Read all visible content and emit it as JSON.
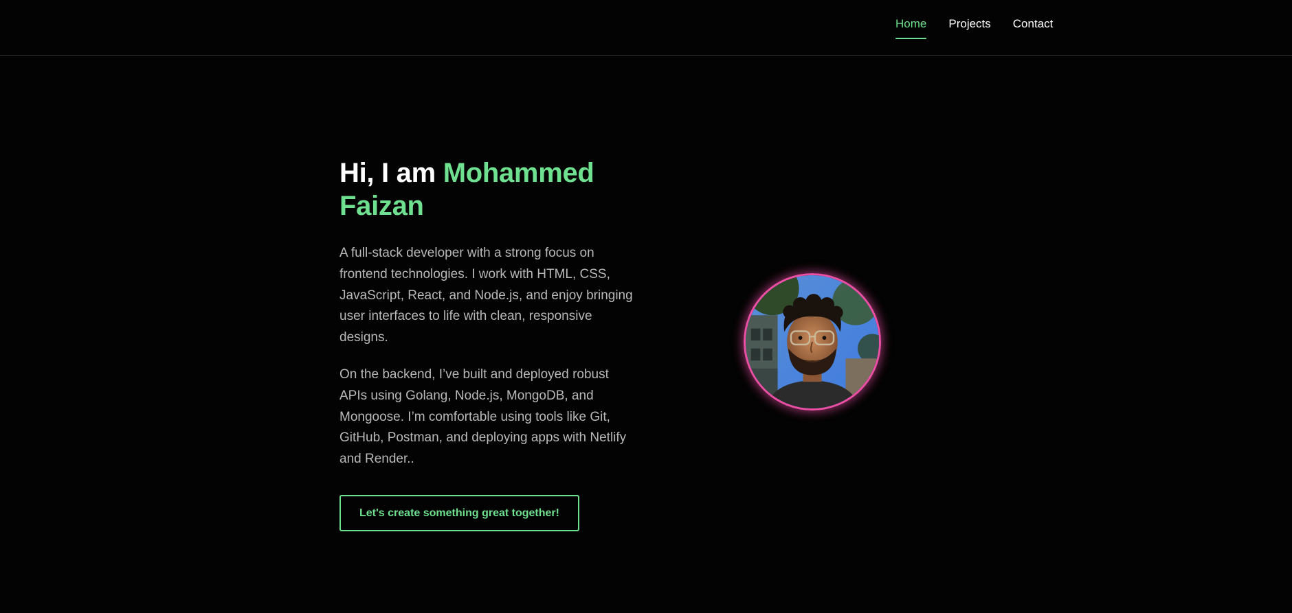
{
  "nav": {
    "items": [
      {
        "label": "Home",
        "active": true
      },
      {
        "label": "Projects",
        "active": false
      },
      {
        "label": "Contact",
        "active": false
      }
    ]
  },
  "hero": {
    "greeting": "Hi, I am ",
    "name": "Mohammed Faizan",
    "paragraph1": "A full-stack developer with a strong focus on frontend technologies. I work with HTML, CSS, JavaScript, React, and Node.js, and enjoy bringing user interfaces to life with clean, responsive designs.",
    "paragraph2": "On the backend, I’ve built and deployed robust APIs using Golang, Node.js, MongoDB, and Mongoose. I’m comfortable using tools like Git, GitHub, Postman, and deploying apps with Netlify and Render..",
    "cta_label": "Let's create something great together!"
  },
  "colors": {
    "background": "#030303",
    "accent": "#6ee08f",
    "avatar_ring": "#ec4fa4",
    "body_text": "#b9b9b9"
  }
}
